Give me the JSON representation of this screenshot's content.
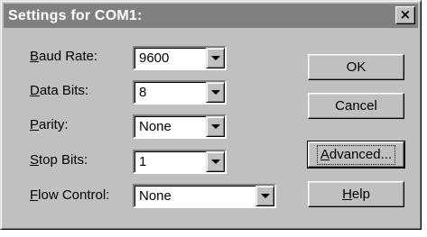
{
  "window": {
    "title": "Settings for COM1:",
    "close_glyph": "×"
  },
  "fields": [
    {
      "label_acc": "B",
      "label_rest": "aud Rate:",
      "value": "9600"
    },
    {
      "label_acc": "D",
      "label_rest": "ata Bits:",
      "value": "8"
    },
    {
      "label_acc": "P",
      "label_rest": "arity:",
      "value": "None"
    },
    {
      "label_acc": "S",
      "label_rest": "top Bits:",
      "value": "1"
    },
    {
      "label_acc": "F",
      "label_rest": "low Control:",
      "value": "None"
    }
  ],
  "buttons": {
    "ok": "OK",
    "cancel": "Cancel",
    "advanced": {
      "acc": "A",
      "rest": "dvanced..."
    },
    "help": {
      "acc": "H",
      "rest": "elp"
    }
  },
  "icons": {
    "dropdown": "chevron-down-icon",
    "close": "close-icon"
  }
}
